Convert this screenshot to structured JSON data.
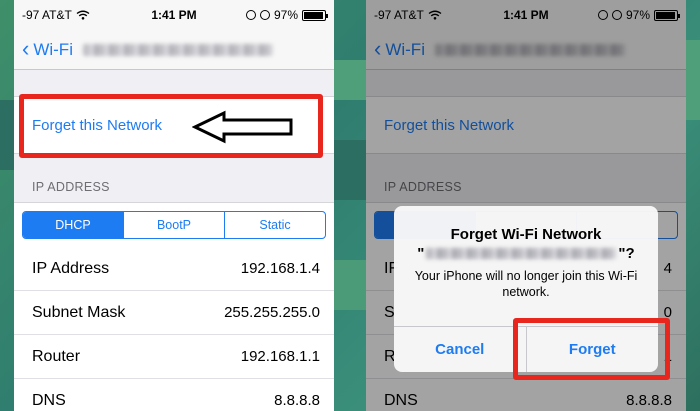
{
  "colors": {
    "ios_blue": "#1e7cf2",
    "highlight_red": "#e8261e",
    "background_green": "#3f8f6a"
  },
  "left_screen": {
    "status_bar": {
      "carrier": "-97 AT&T",
      "time": "1:41 PM",
      "battery": "97%",
      "battery_level": 0.97
    },
    "nav": {
      "back_label": "Wi-Fi",
      "back_icon": "chevron-left-icon"
    },
    "forget_label": "Forget this Network",
    "ip_section_header": "IP ADDRESS",
    "segments": [
      "DHCP",
      "BootP",
      "Static"
    ],
    "selected_segment": "DHCP",
    "info_rows": [
      {
        "label": "IP Address",
        "value": "192.168.1.4"
      },
      {
        "label": "Subnet Mask",
        "value": "255.255.255.0"
      },
      {
        "label": "Router",
        "value": "192.168.1.1"
      },
      {
        "label": "DNS",
        "value": "8.8.8.8"
      }
    ],
    "annotation_icon": "left-arrow-outline-icon"
  },
  "right_screen": {
    "status_bar": {
      "carrier": "-97 AT&T",
      "time": "1:41 PM",
      "battery": "97%",
      "battery_level": 0.97
    },
    "nav": {
      "back_label": "Wi-Fi"
    },
    "forget_label": "Forget this Network",
    "ip_section_header": "IP ADDRESS",
    "partial_rows": [
      {
        "label_fragment": "IF",
        "value_fragment": "4"
      },
      {
        "label_fragment": "S",
        "value_fragment": "0"
      },
      {
        "label_fragment": "R",
        "value_fragment": "1"
      },
      {
        "label": "DNS",
        "value": "8.8.8.8"
      }
    ],
    "alert": {
      "title": "Forget Wi-Fi Network",
      "ssid_prefix": "\"",
      "ssid_suffix": "\"?",
      "message": "Your iPhone will no longer join this Wi-Fi network.",
      "cancel_label": "Cancel",
      "forget_label": "Forget"
    }
  }
}
